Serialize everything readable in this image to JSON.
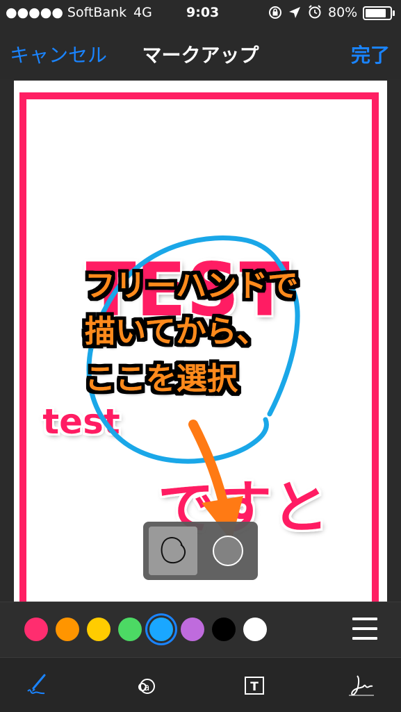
{
  "status": {
    "carrier": "●●●●● SoftBank",
    "network": "4G",
    "time": "9:03",
    "battery": "80%"
  },
  "nav": {
    "cancel": "キャンセル",
    "title": "マークアップ",
    "done": "完了"
  },
  "document": {
    "big_text": "TEST",
    "small_text": "test",
    "bottom_text": "ですと"
  },
  "annotation": {
    "line1": "フリーハンドで",
    "line2": "描いてから、",
    "line3": "ここを選択"
  },
  "palette": {
    "colors": [
      "#ff2d6f",
      "#ff9500",
      "#ffcc00",
      "#4cd964",
      "#1aa7ff",
      "#bf6bdd",
      "#000000",
      "#ffffff"
    ],
    "selected_index": 4
  },
  "toolbar": {
    "tools": [
      "sketch-tool",
      "magnifier-tool",
      "text-tool",
      "signature-tool"
    ]
  }
}
